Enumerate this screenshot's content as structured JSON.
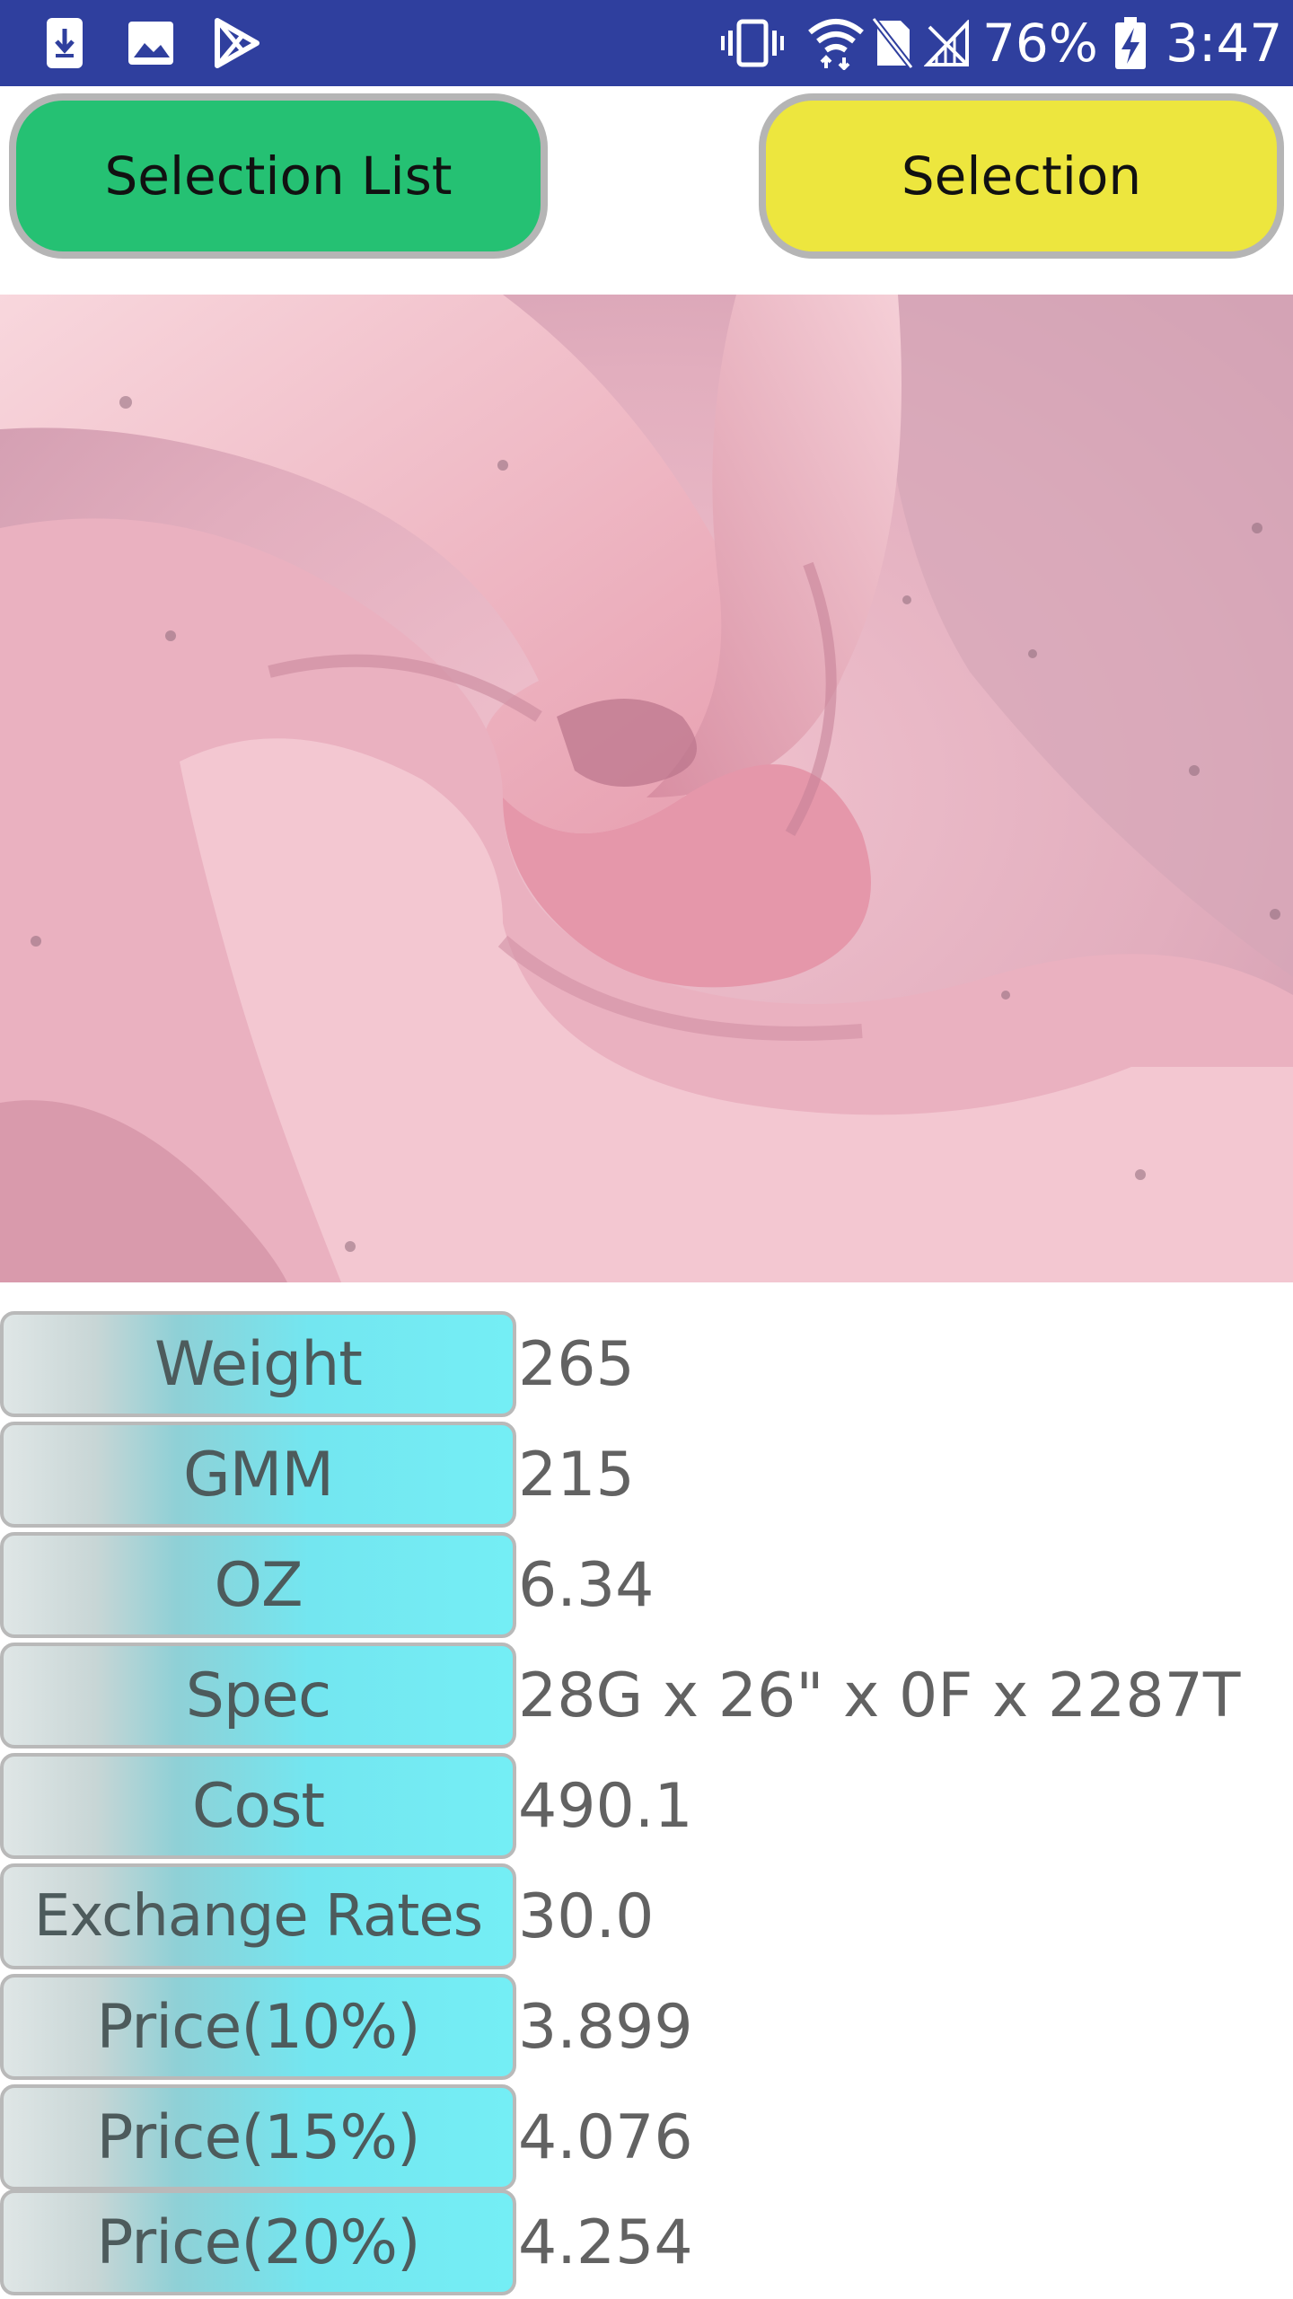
{
  "status_bar": {
    "battery": "76%",
    "time": "3:47",
    "left_icons": [
      "download-icon",
      "image-icon",
      "play-store-icon"
    ],
    "right_icons": [
      "vibrate-icon",
      "wifi-icon",
      "no-sim-icon",
      "signal-icon",
      "battery-charging-icon"
    ]
  },
  "buttons": {
    "selection_list": "Selection List",
    "selection": "Selection"
  },
  "colors": {
    "status_bar": "#2f3f9e",
    "selection_list_button": "#25c173",
    "selection_button": "#ede63e",
    "label_cell": "#74eef5",
    "fabric": "#e3a8b9"
  },
  "image": {
    "subject": "pink fabric swirl photo"
  },
  "specs": [
    {
      "label": "Weight",
      "value": "265"
    },
    {
      "label": "GMM",
      "value": "215"
    },
    {
      "label": "OZ",
      "value": "6.34"
    },
    {
      "label": "Spec",
      "value": "28G x 26\" x 0F x 2287T"
    },
    {
      "label": "Cost",
      "value": "490.1"
    },
    {
      "label": "Exchange Rates",
      "value": "30.0"
    },
    {
      "label": "Price(10%)",
      "value": "3.899"
    },
    {
      "label": "Price(15%)",
      "value": "4.076"
    },
    {
      "label": "Price(20%)",
      "value": "4.254"
    }
  ]
}
